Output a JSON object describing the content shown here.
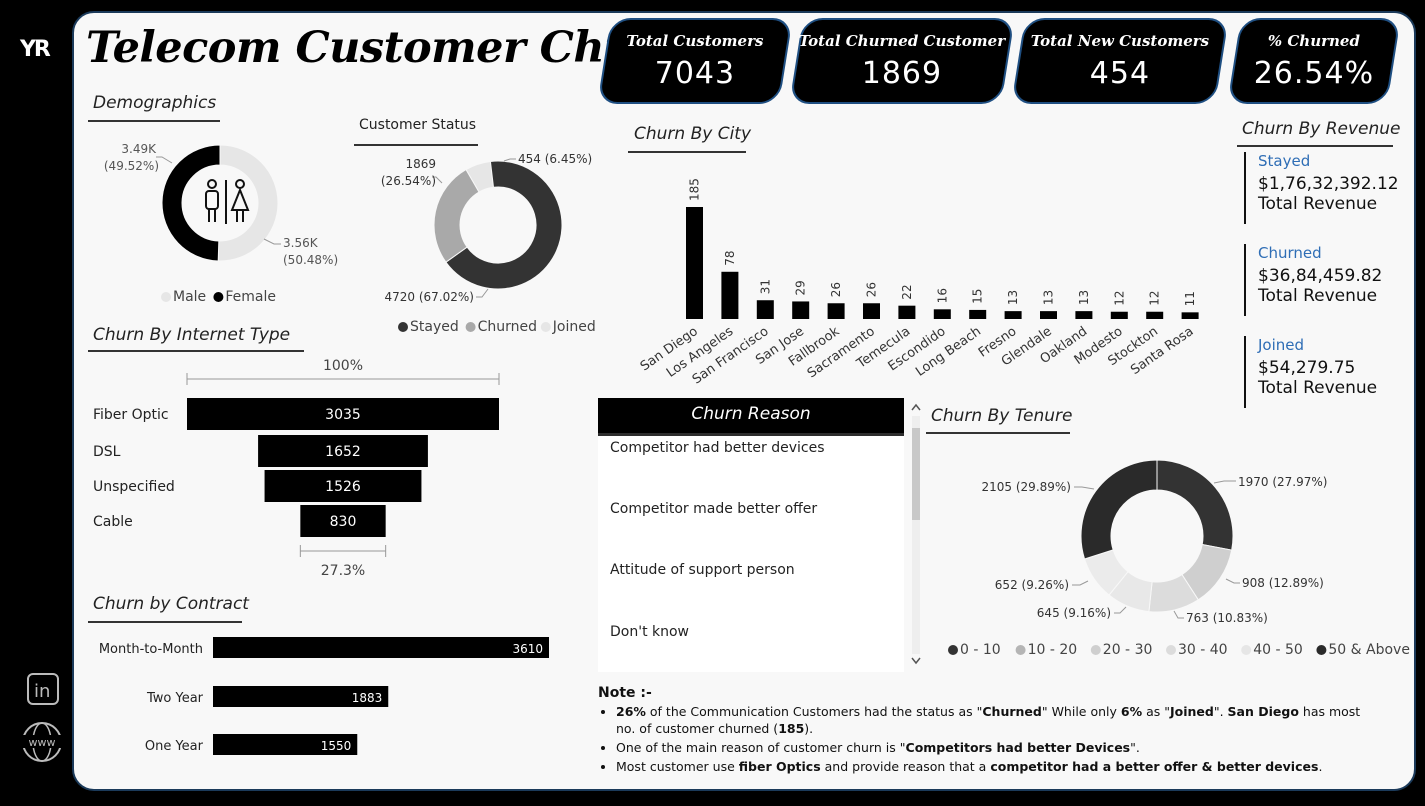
{
  "title": "Telecom Customer Churn",
  "kpis": [
    {
      "label": "Total Customers",
      "value": "7043"
    },
    {
      "label": "Total Churned Customer",
      "value": "1869"
    },
    {
      "label": "Total New Customers",
      "value": "454"
    },
    {
      "label": "% Churned",
      "value": "26.54%"
    }
  ],
  "sections": {
    "demographics": "Demographics",
    "customer_status": "Customer Status",
    "churn_by_city": "Churn By City",
    "churn_by_revenue": "Churn By Revenue",
    "churn_by_internet": "Churn By Internet Type",
    "churn_reason": "Churn Reason",
    "churn_by_tenure": "Churn By Tenure",
    "churn_by_contract": "Churn by Contract"
  },
  "colors": {
    "accent": "#2e6db5",
    "dark": "#000000",
    "stayed": "#333333",
    "churned": "#a9a9a9",
    "joined": "#e6e6e6"
  },
  "rail_icons": [
    "yr-logo",
    "linkedin-icon",
    "globe-www-icon"
  ],
  "rail_icon_text": {
    "logo": "YR",
    "linkedin": "in",
    "www": "www"
  },
  "demographics_center_icon": "male-female-icon",
  "revenue": [
    {
      "label": "Stayed",
      "value": "$1,76,32,392.12",
      "sub": "Total Revenue"
    },
    {
      "label": "Churned",
      "value": "$36,84,459.82",
      "sub": "Total Revenue"
    },
    {
      "label": "Joined",
      "value": "$54,279.75",
      "sub": "Total Revenue"
    }
  ],
  "churn_reasons": [
    "Competitor had better devices",
    "Competitor made better offer",
    "Attitude of support person",
    "Don't know"
  ],
  "note": {
    "title": "Note :-",
    "items": [
      [
        {
          "t": "26%",
          "b": true
        },
        {
          "t": " of the Communication Customers had the status as \""
        },
        {
          "t": "Churned",
          "b": true
        },
        {
          "t": "\" While only "
        },
        {
          "t": "6%",
          "b": true
        },
        {
          "t": " as \""
        },
        {
          "t": "Joined",
          "b": true
        },
        {
          "t": "\". "
        },
        {
          "t": "San Diego",
          "b": true
        },
        {
          "t": " has most no. of customer churned ("
        },
        {
          "t": "185",
          "b": true
        },
        {
          "t": ")."
        }
      ],
      [
        {
          "t": "One of the main reason of customer churn is \""
        },
        {
          "t": "Competitors had better Devices",
          "b": true
        },
        {
          "t": "\"."
        }
      ],
      [
        {
          "t": "Most customer use "
        },
        {
          "t": "fiber Optics",
          "b": true
        },
        {
          "t": " and provide reason that a "
        },
        {
          "t": "competitor had a better offer & better devices",
          "b": true
        },
        {
          "t": "."
        }
      ]
    ]
  },
  "chart_data": [
    {
      "type": "pie",
      "id": "demographics",
      "title": "Demographics",
      "categories": [
        "Male",
        "Female"
      ],
      "values": [
        3.56,
        3.49
      ],
      "labels": [
        "3.56K (50.48%)",
        "3.49K (49.52%)"
      ],
      "colors": [
        "#e6e6e6",
        "#000000"
      ],
      "legend": "bottom"
    },
    {
      "type": "pie",
      "id": "customer_status",
      "title": "Customer Status",
      "categories": [
        "Stayed",
        "Churned",
        "Joined"
      ],
      "values": [
        4720,
        1869,
        454
      ],
      "labels": [
        "4720 (67.02%)",
        "1869 (26.54%)",
        "454 (6.45%)"
      ],
      "colors": [
        "#333333",
        "#a9a9a9",
        "#e6e6e6"
      ],
      "legend": "bottom"
    },
    {
      "type": "bar",
      "id": "churn_by_city",
      "title": "Churn By City",
      "categories": [
        "San Diego",
        "Los Angeles",
        "San Francisco",
        "San Jose",
        "Fallbrook",
        "Sacramento",
        "Temecula",
        "Escondido",
        "Long Beach",
        "Fresno",
        "Glendale",
        "Oakland",
        "Modesto",
        "Stockton",
        "Santa Rosa"
      ],
      "values": [
        185,
        78,
        31,
        29,
        26,
        26,
        22,
        16,
        15,
        13,
        13,
        13,
        12,
        12,
        11
      ],
      "ylim": [
        0,
        185
      ]
    },
    {
      "type": "bar",
      "id": "churn_by_internet",
      "title": "Churn By Internet Type",
      "orientation": "funnel",
      "categories": [
        "Fiber Optic",
        "DSL",
        "Unspecified",
        "Cable"
      ],
      "values": [
        3035,
        1652,
        1526,
        830
      ],
      "top_label": "100%",
      "bottom_label": "27.3%"
    },
    {
      "type": "pie",
      "id": "churn_by_tenure",
      "title": "Churn By Tenure",
      "categories": [
        "0 - 10",
        "10 - 20",
        "20 - 30",
        "30 - 40",
        "40 - 50",
        "50 & Above"
      ],
      "values": [
        1970,
        908,
        763,
        645,
        652,
        2105
      ],
      "labels": [
        "1970 (27.97%)",
        "908 (12.89%)",
        "763 (10.83%)",
        "645 (9.16%)",
        "652 (9.26%)",
        "2105 (29.89%)"
      ],
      "colors": [
        "#333333",
        "#cfcfcf",
        "#dcdcdc",
        "#e8e8e8",
        "#ebebeb",
        "#2a2a2a"
      ],
      "legend_colors": [
        "#333333",
        "#b5b5b5",
        "#cfcfcf",
        "#dcdcdc",
        "#e6e6e6",
        "#2a2a2a"
      ],
      "legend": "bottom"
    },
    {
      "type": "bar",
      "id": "churn_by_contract",
      "title": "Churn by Contract",
      "orientation": "horizontal",
      "categories": [
        "Month-to-Month",
        "Two Year",
        "One Year"
      ],
      "values": [
        3610,
        1883,
        1550
      ]
    }
  ]
}
